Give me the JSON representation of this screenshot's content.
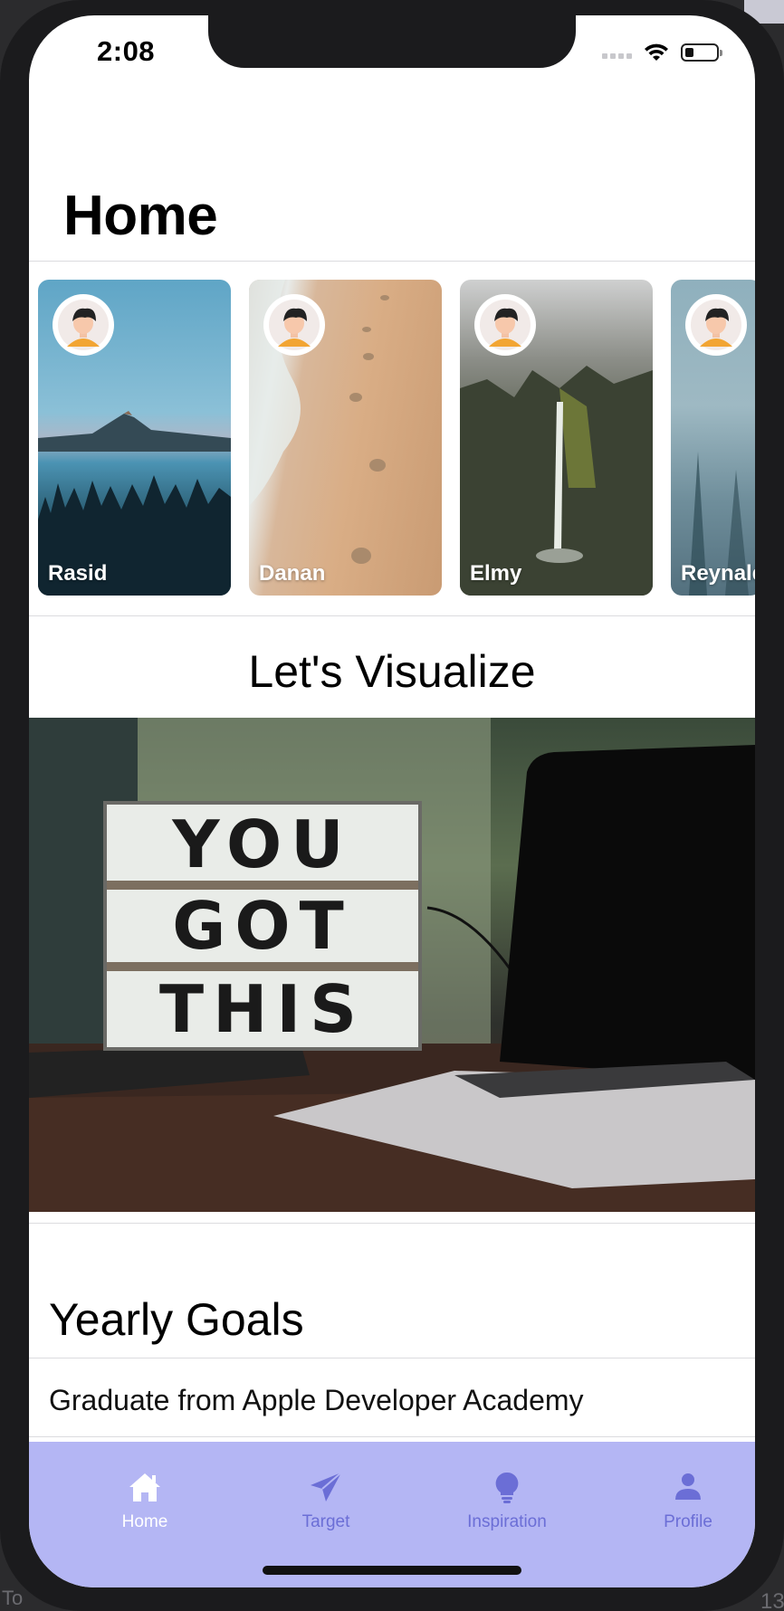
{
  "status_bar": {
    "time": "2:08"
  },
  "header": {
    "title": "Home"
  },
  "stories": [
    {
      "name": "Rasid"
    },
    {
      "name": "Danan"
    },
    {
      "name": "Elmy"
    },
    {
      "name": "Reynald"
    }
  ],
  "visualize": {
    "heading": "Let's Visualize",
    "board_lines": [
      "YOU",
      "GOT",
      "THIS"
    ]
  },
  "goals": {
    "heading": "Yearly Goals",
    "items": [
      "Graduate from Apple Developer Academy"
    ]
  },
  "tab_bar": {
    "tabs": [
      {
        "label": "Home",
        "icon": "house-icon"
      },
      {
        "label": "Target",
        "icon": "paperplane-icon"
      },
      {
        "label": "Inspiration",
        "icon": "lightbulb-icon"
      },
      {
        "label": "Profile",
        "icon": "person-icon"
      }
    ],
    "active_index": 0,
    "background": "#b4b6f4",
    "inactive_color": "#6b6ed6",
    "active_color": "#ffffff"
  },
  "desktop": {
    "corner_left": "To",
    "corner_right": "13"
  }
}
